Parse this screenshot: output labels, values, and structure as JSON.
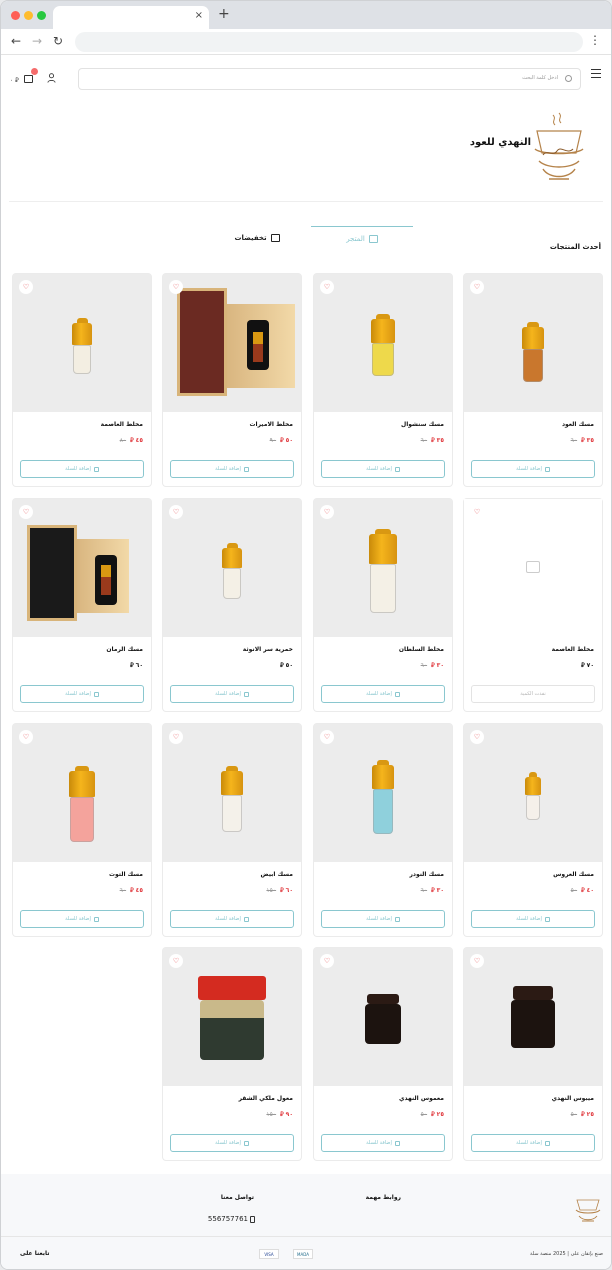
{
  "browser": {
    "tab_close": "×",
    "new_tab": "+",
    "back": "←",
    "forward": "→",
    "reload": "↻",
    "menu": "⋮"
  },
  "header": {
    "search_placeholder": "ادخل كلمة البحث",
    "cart_amount": "٠ ⃁"
  },
  "store": {
    "name": "النهدي للعود"
  },
  "tabs": [
    {
      "label": "المتجر",
      "icon": "store-icon"
    },
    {
      "label": "تخفيضات",
      "icon": "shop-icon"
    }
  ],
  "section_title": "أحدث المنتجات",
  "currency": "⃁",
  "add_label": "إضافة للسلة",
  "notify_label": "نفذت الكمية",
  "products": [
    {
      "name": "مسك العود",
      "price": "٣٥",
      "old": "٦٠",
      "on_sale": true,
      "image": "bottle-amber"
    },
    {
      "name": "مسك سنشوال",
      "price": "٣٥",
      "old": "٦٠",
      "on_sale": true,
      "image": "bottle-yellow"
    },
    {
      "name": "مخلط الاميرات",
      "price": "٥٠",
      "old": "٩٠",
      "on_sale": true,
      "image": "box-red"
    },
    {
      "name": "مخلط العاصمة",
      "price": "٤٥",
      "old": "٨٠",
      "on_sale": true,
      "image": "bottle-clear"
    },
    {
      "name": "مخلط العاصمة",
      "price": "٧٠",
      "old": "",
      "on_sale": false,
      "image": "placeholder",
      "out_of_stock": true
    },
    {
      "name": "مخلط السلطان",
      "price": "٣٠",
      "old": "٦٠",
      "on_sale": true,
      "image": "bottle-big"
    },
    {
      "name": "خمرية سر الانوثة",
      "price": "٥٠",
      "old": "",
      "on_sale": false,
      "image": "bottle-small"
    },
    {
      "name": "مسك الرمان",
      "price": "٦٠",
      "old": "",
      "on_sale": false,
      "image": "box-black"
    },
    {
      "name": "مسك العروس",
      "price": "٤٠",
      "old": "٥٠",
      "on_sale": true,
      "image": "bottle-mini"
    },
    {
      "name": "مسك النودر",
      "price": "٣٠",
      "old": "٦٠",
      "on_sale": true,
      "image": "bottle-blue"
    },
    {
      "name": "مسك ابيض",
      "price": "٦٠",
      "old": "١٥٠",
      "on_sale": true,
      "image": "bottle-white"
    },
    {
      "name": "مسك التوت",
      "price": "٤٥",
      "old": "٦٠",
      "on_sale": true,
      "image": "bottle-pink"
    },
    {
      "name": "ميبوس النهدي",
      "price": "٢٥",
      "old": "٥٠",
      "on_sale": true,
      "image": "jar-dark"
    },
    {
      "name": "معموس النهدي",
      "price": "٢٥",
      "old": "٥٠",
      "on_sale": true,
      "image": "jar-small"
    },
    {
      "name": "معول ملكي الشقر",
      "price": "٩٠",
      "old": "١٥٠",
      "on_sale": true,
      "image": "jar-red"
    }
  ],
  "footer": {
    "links_title": "روابط مهمة",
    "contact_title": "تواصل معنا",
    "phone": "556757761",
    "copyright": "صنع بإتقان على | 2025 منصة سلة",
    "follow": "تابعنا على",
    "payments": [
      "VISA",
      "MADA"
    ]
  },
  "colors": {
    "accent": "#8ac7cf",
    "sale": "#e0393e"
  }
}
